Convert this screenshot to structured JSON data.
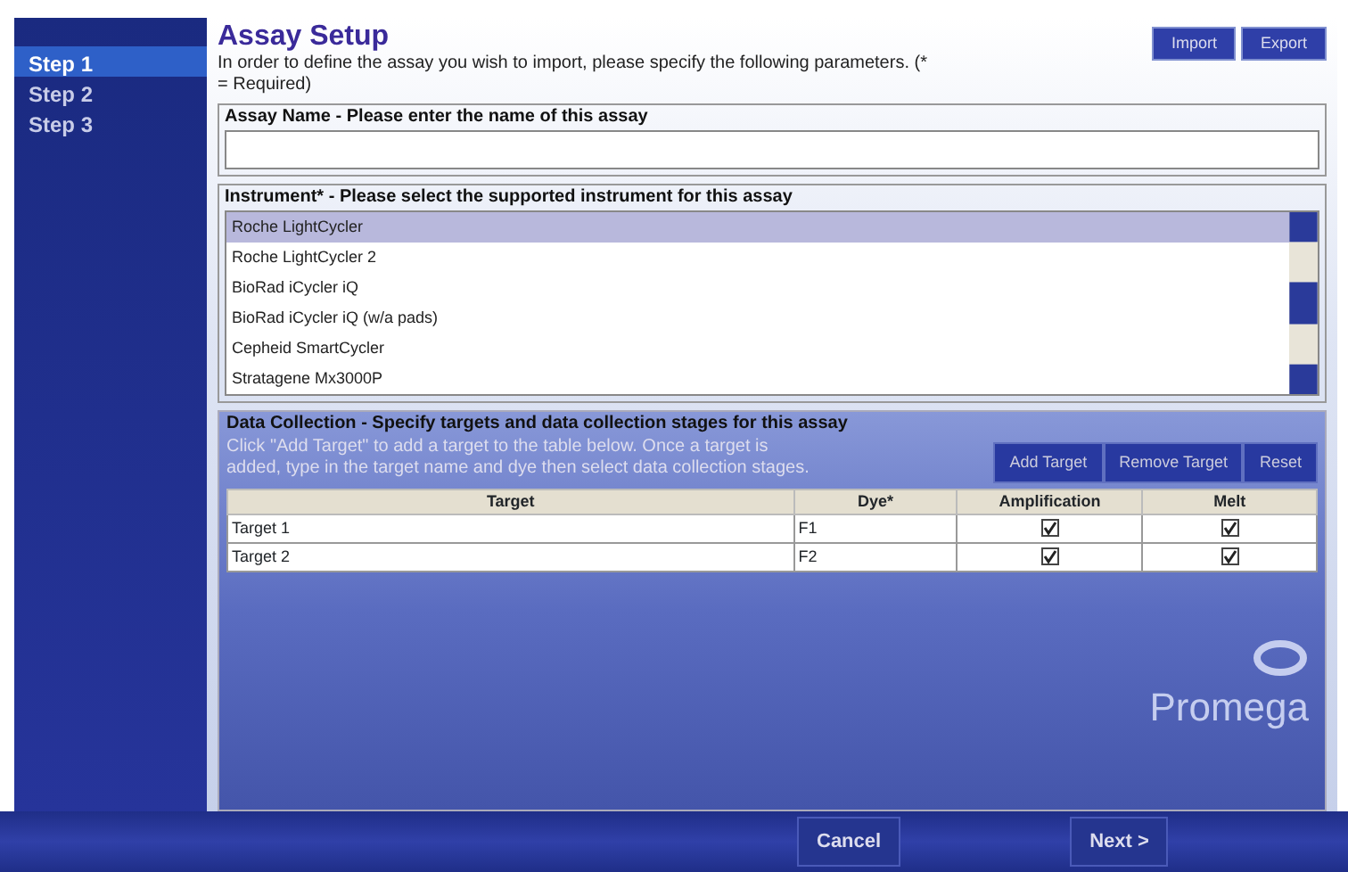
{
  "steps": [
    {
      "label": "Step 1",
      "selected": true
    },
    {
      "label": "Step 2",
      "selected": false
    },
    {
      "label": "Step 3",
      "selected": false
    }
  ],
  "header": {
    "title": "Assay Setup",
    "intro": "In order to define the assay you wish to import, please specify the following parameters. (* = Required)",
    "buttons": [
      "Import",
      "Export"
    ]
  },
  "assay_name": {
    "legend": "Assay Name - Please enter the name of this assay"
  },
  "instrument": {
    "legend": "Instrument* - Please select the supported instrument for this assay",
    "items": [
      {
        "label": "Roche LightCycler",
        "selected": true
      },
      {
        "label": "Roche LightCycler 2",
        "selected": false
      },
      {
        "label": "BioRad iCycler iQ",
        "selected": false
      },
      {
        "label": "BioRad iCycler iQ (w/a pads)",
        "selected": false
      },
      {
        "label": "Cepheid SmartCycler",
        "selected": false
      },
      {
        "label": "Stratagene Mx3000P",
        "selected": false
      }
    ]
  },
  "data_collection": {
    "legend": "Data Collection - Specify targets and data collection stages for this assay",
    "help": "Click \"Add Target\" to add a target to the table below.  Once a target is added, type in the target name and dye then select data collection stages.",
    "buttons": [
      "Add Target",
      "Remove Target",
      "Reset"
    ],
    "table": {
      "columns": [
        "Target",
        "Dye*",
        "Amplification",
        "Melt"
      ],
      "rows": [
        {
          "target": "Target 1",
          "dye": "F1",
          "amplification": true,
          "melt": true
        },
        {
          "target": "Target 2",
          "dye": "F2",
          "amplification": true,
          "melt": true
        }
      ]
    }
  },
  "logo": {
    "text": "Promega"
  },
  "footer": {
    "buttons": [
      "Cancel",
      "Next >"
    ]
  }
}
